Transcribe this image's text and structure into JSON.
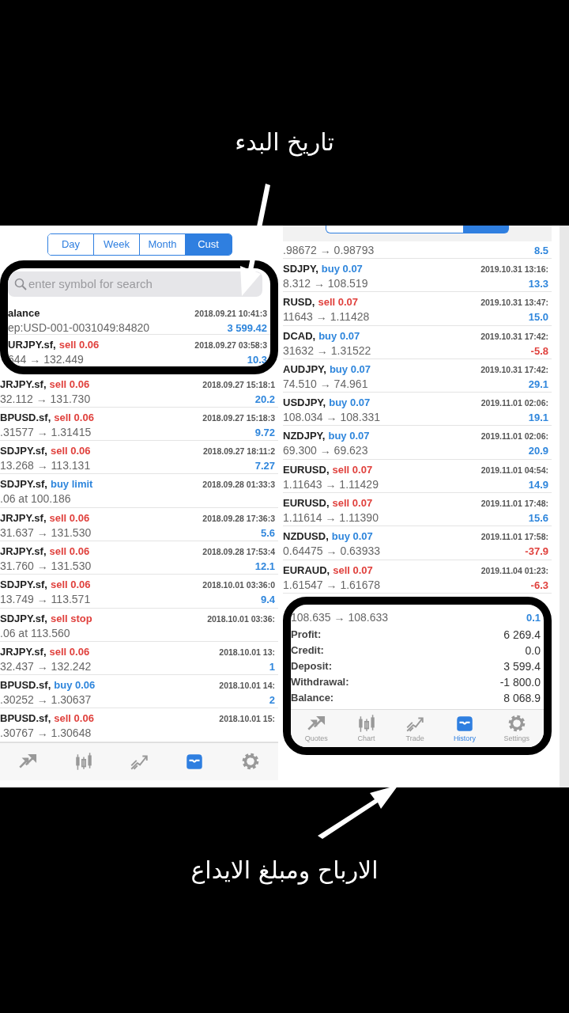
{
  "annotations": {
    "top": "تاريخ البدء",
    "bottom": "الارباح ومبلغ الايداع"
  },
  "left": {
    "tabs": [
      {
        "label": "Day",
        "selected": false
      },
      {
        "label": "Week",
        "selected": false
      },
      {
        "label": "Month",
        "selected": false
      },
      {
        "label": "Cust",
        "selected": true
      }
    ],
    "search": {
      "placeholder": "enter symbol for search"
    },
    "rows": [
      {
        "symbol": "alance",
        "prices": "ep:USD-001-0031049:84820",
        "time": "2018.09.21 10:41:3",
        "profit": {
          "text": "3 599.42",
          "color": "#2f86dc"
        }
      },
      {
        "symbol": "URJPY.sf,",
        "action": {
          "text": "sell 0.06",
          "color": "#e0413d"
        },
        "prices": "644 → 132.449",
        "time": "2018.09.27 03:58:3",
        "profit": {
          "text": "10.3",
          "color": "#2f86dc"
        }
      },
      {
        "symbol": "JRJPY.sf,",
        "action": {
          "text": "sell 0.06",
          "color": "#e0413d"
        },
        "prices": "32.112 → 131.730",
        "time": "2018.09.27 15:18:1",
        "profit": {
          "text": "20.2",
          "color": "#2f86dc"
        }
      },
      {
        "symbol": "BPUSD.sf,",
        "action": {
          "text": "sell 0.06",
          "color": "#e0413d"
        },
        "prices": ".31577 → 1.31415",
        "time": "2018.09.27 15:18:3",
        "profit": {
          "text": "9.72",
          "color": "#2f86dc"
        }
      },
      {
        "symbol": "SDJPY.sf,",
        "action": {
          "text": "sell 0.06",
          "color": "#e0413d"
        },
        "prices": "13.268 → 113.131",
        "time": "2018.09.27 18:11:2",
        "profit": {
          "text": "7.27",
          "color": "#2f86dc"
        }
      },
      {
        "symbol": "SDJPY.sf,",
        "action": {
          "text": "buy limit",
          "color": "#2f86dc"
        },
        "prices": ".06 at 100.186",
        "time": "2018.09.28 01:33:3"
      },
      {
        "symbol": "JRJPY.sf,",
        "action": {
          "text": "sell 0.06",
          "color": "#e0413d"
        },
        "prices": "31.637 → 131.530",
        "time": "2018.09.28 17:36:3",
        "profit": {
          "text": "5.6",
          "color": "#2f86dc"
        }
      },
      {
        "symbol": "JRJPY.sf,",
        "action": {
          "text": "sell 0.06",
          "color": "#e0413d"
        },
        "prices": "31.760 → 131.530",
        "time": "2018.09.28 17:53:4",
        "profit": {
          "text": "12.1",
          "color": "#2f86dc"
        }
      },
      {
        "symbol": "SDJPY.sf,",
        "action": {
          "text": "sell 0.06",
          "color": "#e0413d"
        },
        "prices": "13.749 → 113.571",
        "time": "2018.10.01 03:36:0",
        "profit": {
          "text": "9.4",
          "color": "#2f86dc"
        }
      },
      {
        "symbol": "SDJPY.sf,",
        "action": {
          "text": "sell stop",
          "color": "#e0413d"
        },
        "prices": ".06 at 113.560",
        "time": "2018.10.01 03:36:"
      },
      {
        "symbol": "JRJPY.sf,",
        "action": {
          "text": "sell 0.06",
          "color": "#e0413d"
        },
        "prices": "32.437 → 132.242",
        "time": "2018.10.01 13:",
        "profit": {
          "text": "1",
          "color": "#2f86dc"
        }
      },
      {
        "symbol": "BPUSD.sf,",
        "action": {
          "text": "buy 0.06",
          "color": "#2f86dc"
        },
        "prices": ".30252 → 1.30637",
        "time": "2018.10.01 14:",
        "profit": {
          "text": "2",
          "color": "#2f86dc"
        }
      },
      {
        "symbol": "BPUSD.sf,",
        "action": {
          "text": "sell 0.06",
          "color": "#e0413d"
        },
        "prices": ".30767 → 1.30648",
        "time": "2018.10.01 15:"
      }
    ],
    "tabbar": [
      {
        "kind": "quotes",
        "selected": false
      },
      {
        "kind": "chart",
        "selected": false
      },
      {
        "kind": "trade",
        "selected": false
      },
      {
        "kind": "history",
        "selected": true
      },
      {
        "kind": "settings",
        "selected": false
      }
    ]
  },
  "right": {
    "first_row": {
      "prices": ".98672 → 0.98793",
      "profit": {
        "text": "8.5",
        "color": "#2f86dc"
      }
    },
    "rows": [
      {
        "symbol": "SDJPY,",
        "action": {
          "text": "buy 0.07",
          "color": "#2f86dc"
        },
        "prices": "8.312 → 108.519",
        "time": "2019.10.31 13:16:",
        "profit": {
          "text": "13.3",
          "color": "#2f86dc"
        }
      },
      {
        "symbol": "RUSD,",
        "action": {
          "text": "sell 0.07",
          "color": "#e0413d"
        },
        "prices": "11643 → 1.11428",
        "time": "2019.10.31 13:47:",
        "profit": {
          "text": "15.0",
          "color": "#2f86dc"
        }
      },
      {
        "symbol": "DCAD,",
        "action": {
          "text": "buy 0.07",
          "color": "#2f86dc"
        },
        "prices": "31632 → 1.31522",
        "time": "2019.10.31 17:42:",
        "profit": {
          "text": "-5.8",
          "color": "#e0413d"
        }
      },
      {
        "symbol": "AUDJPY,",
        "action": {
          "text": "buy 0.07",
          "color": "#2f86dc"
        },
        "prices": "74.510 → 74.961",
        "time": "2019.10.31 17:42:",
        "profit": {
          "text": "29.1",
          "color": "#2f86dc"
        }
      },
      {
        "symbol": "USDJPY,",
        "action": {
          "text": "buy 0.07",
          "color": "#2f86dc"
        },
        "prices": "108.034 → 108.331",
        "time": "2019.11.01 02:06:",
        "profit": {
          "text": "19.1",
          "color": "#2f86dc"
        }
      },
      {
        "symbol": "NZDJPY,",
        "action": {
          "text": "buy 0.07",
          "color": "#2f86dc"
        },
        "prices": "69.300 → 69.623",
        "time": "2019.11.01 02:06:",
        "profit": {
          "text": "20.9",
          "color": "#2f86dc"
        }
      },
      {
        "symbol": "EURUSD,",
        "action": {
          "text": "sell 0.07",
          "color": "#e0413d"
        },
        "prices": "1.11643 → 1.11429",
        "time": "2019.11.01 04:54:",
        "profit": {
          "text": "14.9",
          "color": "#2f86dc"
        }
      },
      {
        "symbol": "EURUSD,",
        "action": {
          "text": "sell 0.07",
          "color": "#e0413d"
        },
        "prices": "1.11614 → 1.11390",
        "time": "2019.11.01 17:48:",
        "profit": {
          "text": "15.6",
          "color": "#2f86dc"
        }
      },
      {
        "symbol": "NZDUSD,",
        "action": {
          "text": "buy 0.07",
          "color": "#2f86dc"
        },
        "prices": "0.64475 → 0.63933",
        "time": "2019.11.01 17:58:",
        "profit": {
          "text": "-37.9",
          "color": "#e0413d"
        }
      },
      {
        "symbol": "EURAUD,",
        "action": {
          "text": "sell 0.07",
          "color": "#e0413d"
        },
        "prices": "1.61547 → 1.61678",
        "time": "2019.11.04 01:23:",
        "profit": {
          "text": "-6.3",
          "color": "#e0413d"
        }
      }
    ],
    "last_row": {
      "prices": "108.635 → 108.633",
      "profit": {
        "text": "0.1",
        "color": "#2f86dc"
      }
    },
    "summary": [
      {
        "label": "Profit:",
        "value": "6 269.4"
      },
      {
        "label": "Credit:",
        "value": "0.0"
      },
      {
        "label": "Deposit:",
        "value": "3 599.4"
      },
      {
        "label": "Withdrawal:",
        "value": "-1 800.0"
      },
      {
        "label": "Balance:",
        "value": "8 068.9"
      }
    ],
    "tabbar": [
      {
        "kind": "quotes",
        "label": "Quotes",
        "selected": false
      },
      {
        "kind": "chart",
        "label": "Chart",
        "selected": false
      },
      {
        "kind": "trade",
        "label": "Trade",
        "selected": false
      },
      {
        "kind": "history",
        "label": "History",
        "selected": true
      },
      {
        "kind": "settings",
        "label": "Settings",
        "selected": false
      }
    ]
  }
}
